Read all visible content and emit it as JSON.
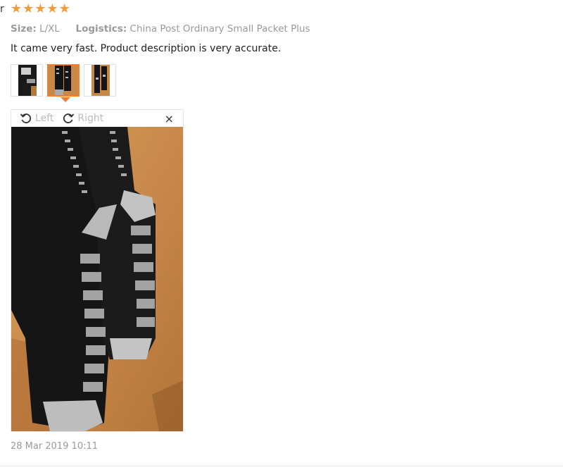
{
  "reviewer": {
    "name_fragment": "r"
  },
  "rating": {
    "stars": 5,
    "max": 5,
    "color": "#f19c38"
  },
  "attributes": {
    "size_label": "Size:",
    "size_value": "L/XL",
    "logistics_label": "Logistics:",
    "logistics_value": "China Post Ordinary Small Packet Plus"
  },
  "review": {
    "text": "It came very fast. Product description is very accurate."
  },
  "thumbnails": {
    "count": 3,
    "selected_index": 1,
    "accent": "#f47e2c"
  },
  "viewer": {
    "rotate_left_label": "Left",
    "rotate_right_label": "Right",
    "close_glyph": "×"
  },
  "date": "28 Mar 2019 10:11"
}
